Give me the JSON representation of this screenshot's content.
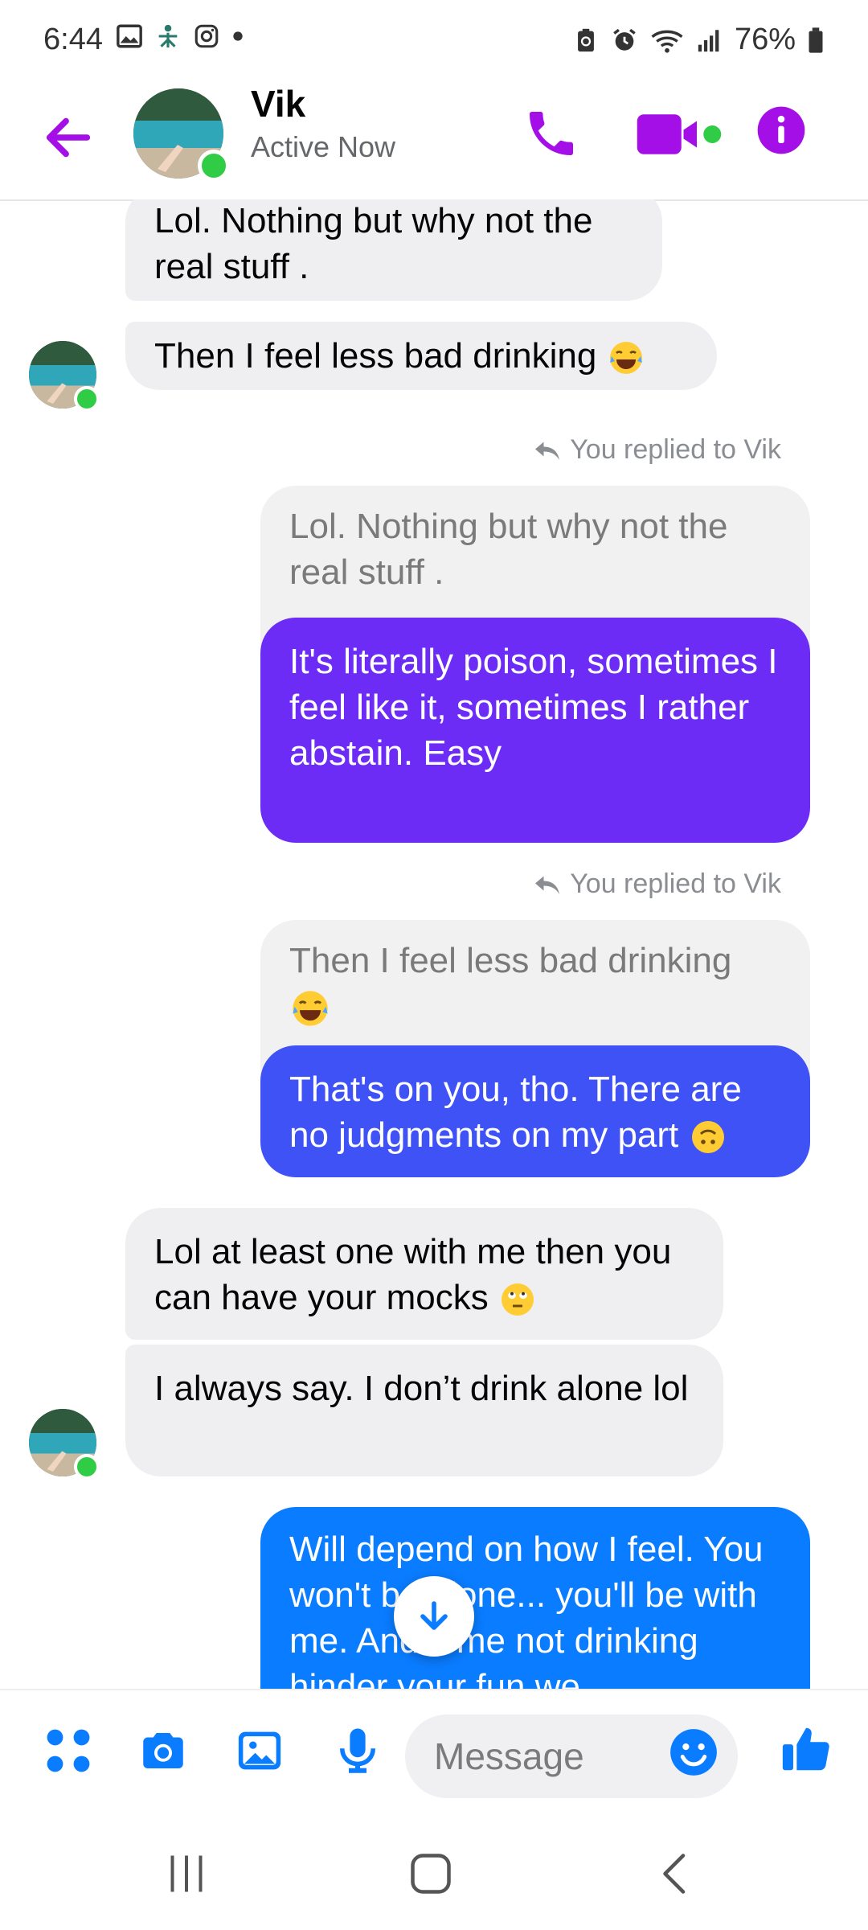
{
  "status_bar": {
    "time": "6:44",
    "battery": "76%",
    "icons": [
      "gallery-icon",
      "ms-app-icon",
      "instagram-icon",
      "dot-icon",
      "battery-saver-icon",
      "alarm-icon",
      "wifi-icon",
      "signal-icon",
      "battery-icon"
    ]
  },
  "header": {
    "contact_name": "Vik",
    "contact_status": "Active Now",
    "accent_color": "#a40fe8",
    "online_color": "#31cc46"
  },
  "messages": [
    {
      "id": "m1",
      "direction": "incoming",
      "text": "Lol. Nothing but why not the real stuff ."
    },
    {
      "id": "m2",
      "direction": "incoming",
      "text": "Then I feel less bad drinking",
      "emoji": "tears-of-joy-emoji"
    },
    {
      "id": "r1",
      "reply_note": "You replied to Vik",
      "quoted": "Lol. Nothing but why not the real stuff .",
      "text": "It's literally poison, sometimes I feel like it, sometimes I rather abstain. Easy",
      "color": "#6c2cf6"
    },
    {
      "id": "r2",
      "reply_note": "You replied to Vik",
      "quoted": "Then I feel less bad drinking",
      "quoted_emoji": "tears-of-joy-emoji",
      "text": "That's on you, tho. There are no judgments on my part",
      "emoji": "upside-down-face-emoji",
      "color": "#3f52f6"
    },
    {
      "id": "m3",
      "direction": "incoming",
      "text": "Lol at least one with me then you can have your mocks",
      "emoji": "eye-roll-emoji"
    },
    {
      "id": "m4",
      "direction": "incoming",
      "text": "I always say. I don’t drink alone lol"
    },
    {
      "id": "m5",
      "direction": "outgoing",
      "text": "Will depend on how I feel. You won't be alone... you'll be with me. And if me not drinking hinder your fun we",
      "color": "#0a7cff"
    }
  ],
  "composer": {
    "placeholder": "Message",
    "icons": [
      "apps-icon",
      "camera-icon",
      "gallery-icon",
      "microphone-icon",
      "emoji-icon",
      "thumbs-up-icon"
    ],
    "accent": "#0a7cff"
  },
  "navigation": [
    "recents-icon",
    "home-icon",
    "back-icon"
  ]
}
